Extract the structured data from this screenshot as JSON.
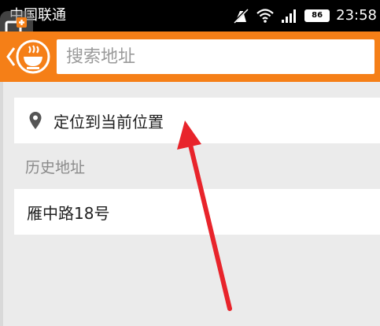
{
  "status_bar": {
    "carrier": "中国联通",
    "battery": "86",
    "time": "23:58"
  },
  "header": {
    "search_placeholder": "搜索地址",
    "color": "#f57f17"
  },
  "locate": {
    "label": "定位到当前位置",
    "icon": "location-pin-icon"
  },
  "history": {
    "title": "历史地址",
    "items": [
      {
        "label": "雁中路18号"
      }
    ]
  },
  "annotation": {
    "arrow_color": "#e8242b"
  }
}
